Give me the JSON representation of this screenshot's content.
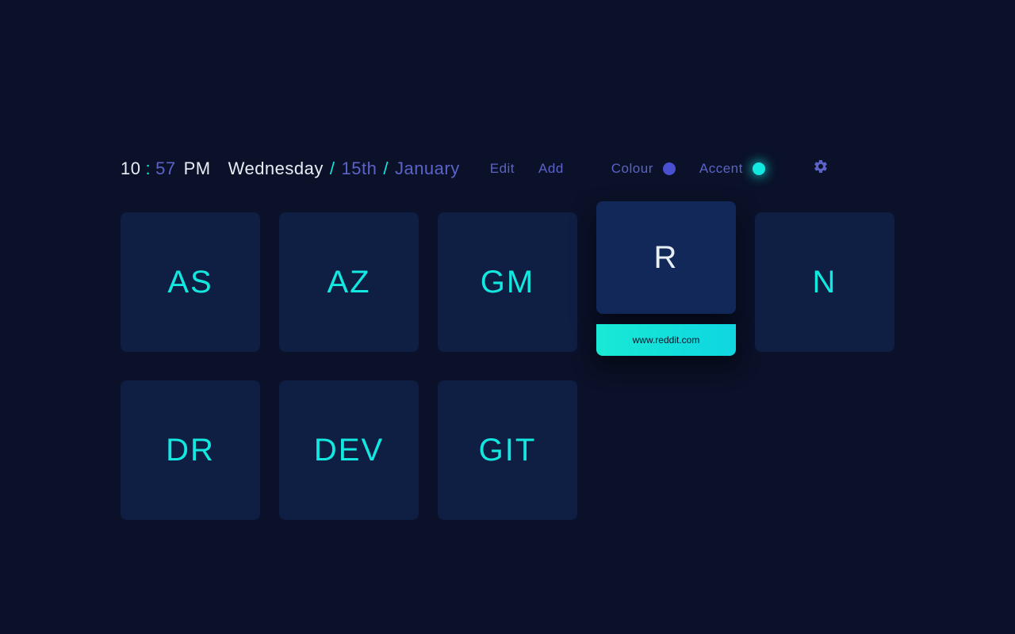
{
  "time": {
    "hour": "10",
    "colon": ":",
    "minute": "57",
    "ampm": "PM"
  },
  "date": {
    "weekday": "Wednesday",
    "sep": "/",
    "day": "15th",
    "month": "January"
  },
  "actions": {
    "edit": "Edit",
    "add": "Add"
  },
  "controls": {
    "colour_label": "Colour",
    "accent_label": "Accent"
  },
  "colors": {
    "colour": "#4a51d1",
    "accent": "#13e8e0"
  },
  "tiles": [
    {
      "label": "AS",
      "active": false
    },
    {
      "label": "AZ",
      "active": false
    },
    {
      "label": "GM",
      "active": false
    },
    {
      "label": "R",
      "active": true,
      "url": "www.reddit.com"
    },
    {
      "label": "N",
      "active": false
    },
    {
      "label": "DR",
      "active": false
    },
    {
      "label": "DEV",
      "active": false
    },
    {
      "label": "GIT",
      "active": false
    }
  ]
}
